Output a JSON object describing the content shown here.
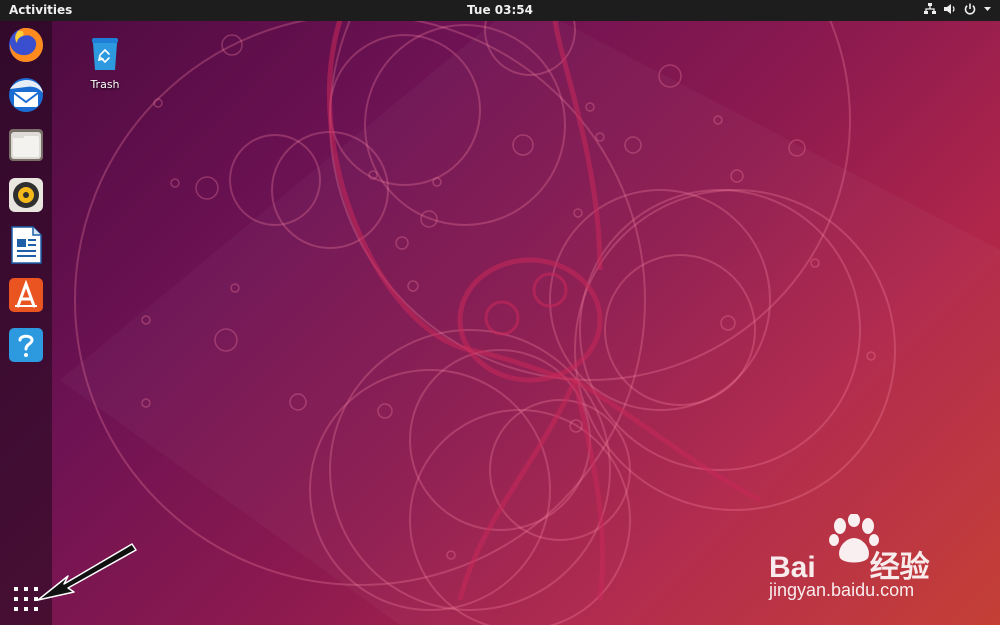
{
  "topbar": {
    "activities_label": "Activities",
    "clock": "Tue 03:54",
    "tray_icons": [
      "network-icon",
      "volume-icon",
      "power-icon",
      "menu-arrow-icon"
    ]
  },
  "dock": {
    "items": [
      {
        "name": "Firefox",
        "icon": "firefox-icon"
      },
      {
        "name": "Thunderbird",
        "icon": "thunderbird-icon"
      },
      {
        "name": "Files",
        "icon": "files-icon"
      },
      {
        "name": "Rhythmbox",
        "icon": "rhythmbox-icon"
      },
      {
        "name": "LibreOffice Writer",
        "icon": "writer-icon"
      },
      {
        "name": "Ubuntu Software",
        "icon": "software-icon"
      },
      {
        "name": "Help",
        "icon": "help-icon"
      }
    ],
    "show_apps_icon": "grid-icon"
  },
  "desktop": {
    "trash_label": "Trash"
  },
  "watermark": {
    "brand": "Bai",
    "brand_suffix": "经验",
    "domain": "jingyan.baidu.com"
  },
  "colors": {
    "topbar": "#1d1d1d",
    "accent_orange": "#e95420"
  }
}
